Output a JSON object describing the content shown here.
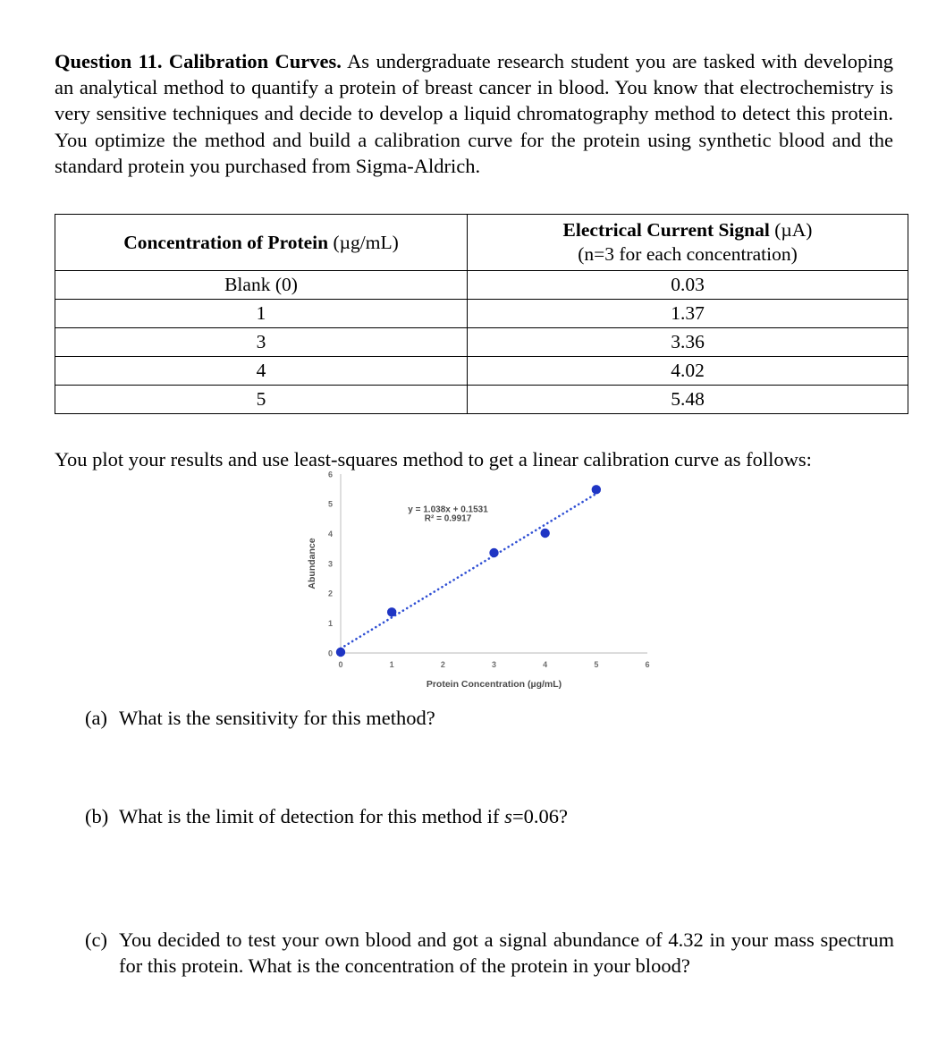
{
  "question": {
    "heading": "Question 11. Calibration Curves.",
    "intro": "As undergraduate research student you are tasked with developing an analytical method to quantify a protein of breast cancer in blood. You know that electrochemistry is very sensitive techniques and decide to develop a liquid chromatography method to detect this protein. You optimize the method and build a calibration curve for the protein using synthetic blood and the standard protein you purchased from Sigma-Aldrich.",
    "plot_lead": "You plot your results and use least-squares method to get a linear calibration curve as follows:"
  },
  "table": {
    "headers": {
      "col1_label": "Concentration of Protein",
      "col1_unit": "(µg/mL)",
      "col2_label": "Electrical Current Signal",
      "col2_unit": "(µA)",
      "col2_sub": "(n=3 for each concentration)"
    },
    "rows": [
      {
        "concentration": "Blank (0)",
        "signal": "0.03"
      },
      {
        "concentration": "1",
        "signal": "1.37"
      },
      {
        "concentration": "3",
        "signal": "3.36"
      },
      {
        "concentration": "4",
        "signal": "4.02"
      },
      {
        "concentration": "5",
        "signal": "5.48"
      }
    ]
  },
  "chart_data": {
    "type": "scatter",
    "title": "",
    "xlabel": "Protein Concentration (µg/mL)",
    "ylabel": "Abundance",
    "x": [
      0,
      1,
      3,
      4,
      5
    ],
    "values": [
      0.03,
      1.37,
      3.36,
      4.02,
      5.48
    ],
    "xlim": [
      0,
      6
    ],
    "ylim": [
      0,
      6
    ],
    "xticks": [
      "0",
      "1",
      "2",
      "3",
      "4",
      "5",
      "6"
    ],
    "yticks": [
      "0",
      "1",
      "2",
      "3",
      "4",
      "5",
      "6"
    ],
    "grid": false,
    "legend": "none",
    "series": [
      {
        "name": "Abundance",
        "values": [
          0.03,
          1.37,
          3.36,
          4.02,
          5.48
        ]
      }
    ],
    "trendline": {
      "type": "linear",
      "slope": 1.038,
      "intercept": 0.1531,
      "style": "dotted",
      "equation_label": "y = 1.038x + 0.1531",
      "r2_label": "R² = 0.9917",
      "r2": 0.9917,
      "x_start": 0,
      "x_end": 5
    },
    "marker_color": "#1f35c4",
    "trend_color": "#2f4fd4",
    "axis_color": "#c8c8c8",
    "tick_label_color": "#6d6d6d"
  },
  "sub_questions": [
    {
      "label": "(a)",
      "text_before": "What is the sensitivity for this method?",
      "italic": "",
      "text_after": ""
    },
    {
      "label": "(b)",
      "text_before": "What is the limit of detection for this method if ",
      "italic": "s",
      "text_after": "=0.06?"
    },
    {
      "label": "(c)",
      "text_before": "You decided to test your own blood and got a signal abundance of 4.32 in your mass spectrum for this protein. What is the concentration of the protein in your blood?",
      "italic": "",
      "text_after": ""
    }
  ]
}
